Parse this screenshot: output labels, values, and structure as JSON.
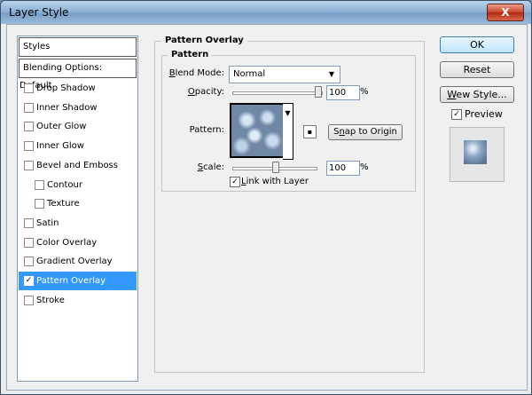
{
  "window": {
    "title": "Layer Style",
    "close_label": "X"
  },
  "left_panel": {
    "header": "Styles",
    "blending_options": "Blending Options: Default",
    "items": [
      {
        "label": "Drop Shadow",
        "checked": false,
        "indent": false,
        "selected": false
      },
      {
        "label": "Inner Shadow",
        "checked": false,
        "indent": false,
        "selected": false
      },
      {
        "label": "Outer Glow",
        "checked": false,
        "indent": false,
        "selected": false
      },
      {
        "label": "Inner Glow",
        "checked": false,
        "indent": false,
        "selected": false
      },
      {
        "label": "Bevel and Emboss",
        "checked": false,
        "indent": false,
        "selected": false
      },
      {
        "label": "Contour",
        "checked": false,
        "indent": true,
        "selected": false
      },
      {
        "label": "Texture",
        "checked": false,
        "indent": true,
        "selected": false
      },
      {
        "label": "Satin",
        "checked": false,
        "indent": false,
        "selected": false
      },
      {
        "label": "Color Overlay",
        "checked": false,
        "indent": false,
        "selected": false
      },
      {
        "label": "Gradient Overlay",
        "checked": false,
        "indent": false,
        "selected": false
      },
      {
        "label": "Pattern Overlay",
        "checked": true,
        "indent": false,
        "selected": true
      },
      {
        "label": "Stroke",
        "checked": false,
        "indent": false,
        "selected": false
      }
    ]
  },
  "pattern_overlay": {
    "group_title": "Pattern Overlay",
    "sub_title": "Pattern",
    "blend_mode_label": "Blend Mode:",
    "blend_mode_value": "Normal",
    "opacity_label": "Opacity:",
    "opacity_value": "100",
    "opacity_unit": "%",
    "pattern_label": "Pattern:",
    "snap_button": "Snap to Origin",
    "scale_label": "Scale:",
    "scale_value": "100",
    "scale_unit": "%",
    "link_label": "Link with Layer",
    "link_checked": true
  },
  "buttons": {
    "ok": "OK",
    "reset": "Reset",
    "new_style": "New Style..."
  },
  "preview": {
    "label": "Preview",
    "checked": true
  },
  "colors": {
    "selection": "#3399ff",
    "title_bar": "#8fb2d6"
  }
}
